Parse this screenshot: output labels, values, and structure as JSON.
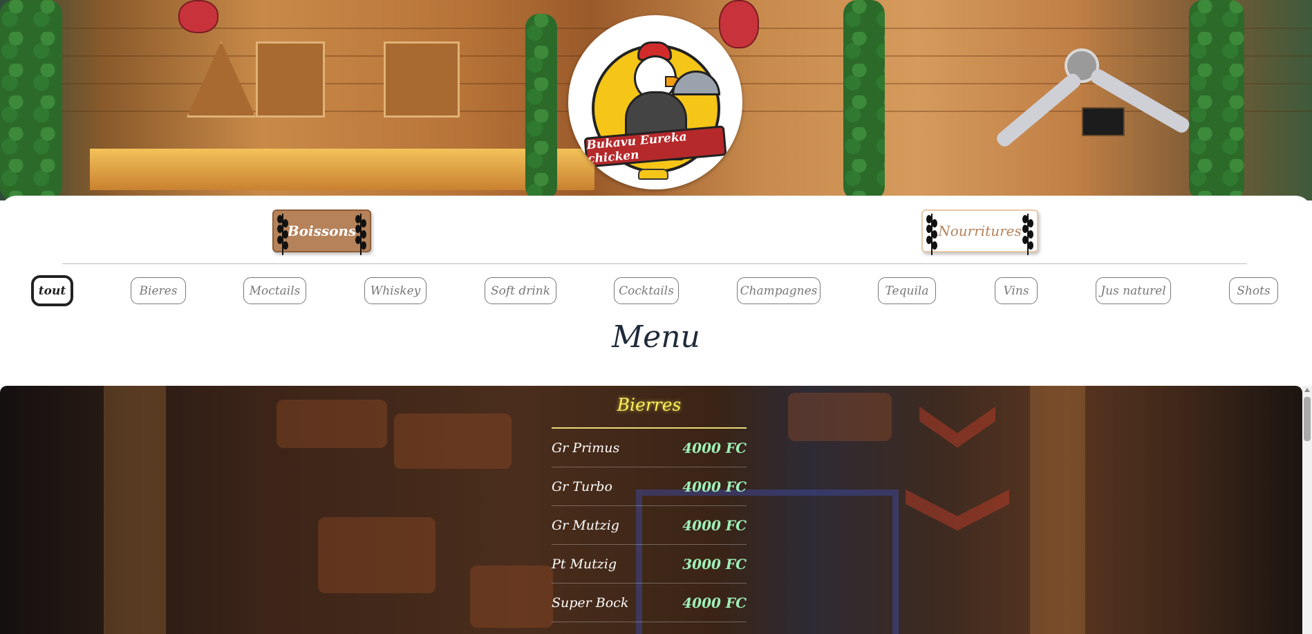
{
  "logo": {
    "text": "Bukavu Eureka chicken"
  },
  "categories": [
    {
      "label": "Boissons",
      "active": true
    },
    {
      "label": "Nourritures",
      "active": false
    }
  ],
  "filters": [
    {
      "label": "tout",
      "active": true
    },
    {
      "label": "Bieres",
      "active": false
    },
    {
      "label": "Moctails",
      "active": false
    },
    {
      "label": "Whiskey",
      "active": false
    },
    {
      "label": "Soft drink",
      "active": false
    },
    {
      "label": "Cocktails",
      "active": false
    },
    {
      "label": "Champagnes",
      "active": false
    },
    {
      "label": "Tequila",
      "active": false
    },
    {
      "label": "Vins",
      "active": false
    },
    {
      "label": "Jus naturel",
      "active": false
    },
    {
      "label": "Shots",
      "active": false
    }
  ],
  "menu": {
    "title": "Menu",
    "section": {
      "title": "Bierres",
      "items": [
        {
          "name": "Gr Primus",
          "price": "4000 FC"
        },
        {
          "name": "Gr Turbo",
          "price": "4000 FC"
        },
        {
          "name": "Gr Mutzig",
          "price": "4000 FC"
        },
        {
          "name": "Pt Mutzig",
          "price": "3000 FC"
        },
        {
          "name": "Super Bock",
          "price": "4000 FC"
        }
      ]
    }
  },
  "colors": {
    "accent_tan": "#b5825a",
    "section_title": "#fff25a",
    "price_green": "#9ff0b8",
    "menu_heading": "#1f2a3a"
  },
  "icons": [
    "wheat-icon",
    "chicken-logo-icon",
    "taxi-icon"
  ]
}
